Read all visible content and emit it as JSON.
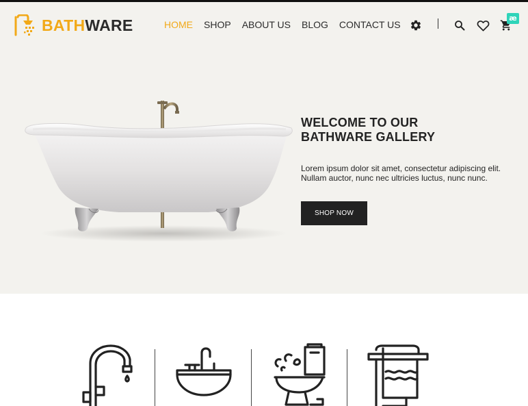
{
  "brand": {
    "name_part1": "BATH",
    "name_part2": "WARE",
    "accent_color": "#f2a918",
    "dark_color": "#2b2b2b",
    "logo_icon": "shower-head-icon"
  },
  "nav": {
    "items": [
      {
        "label": "HOME",
        "active": true
      },
      {
        "label": "SHOP",
        "active": false
      },
      {
        "label": "ABOUT US",
        "active": false
      },
      {
        "label": "BLOG",
        "active": false
      },
      {
        "label": "CONTACT US",
        "active": false
      }
    ]
  },
  "header_icons": [
    "gear-icon",
    "search-icon",
    "heart-icon",
    "cart-icon"
  ],
  "badge": {
    "text": "æ",
    "color": "#2fd4b9"
  },
  "hero": {
    "title_line1": "WELCOME TO OUR",
    "title_line2": "BATHWARE GALLERY",
    "text_line1": "Lorem ipsum dolor sit amet, consectetur adipiscing elit.",
    "text_line2": "Nullam auctor, nunc nec ultricies luctus, nunc nunc.",
    "cta_label": "SHOP NOW",
    "background": "#f3f2ee",
    "image": "clawfoot-bathtub"
  },
  "categories": {
    "icons": [
      "faucet-icon",
      "sink-icon",
      "toilet-icon",
      "towel-icon"
    ]
  }
}
